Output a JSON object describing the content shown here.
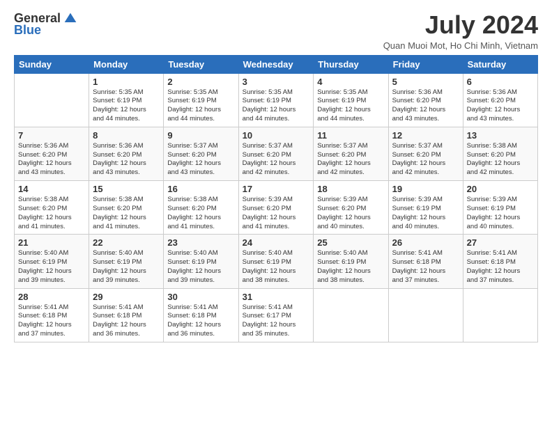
{
  "header": {
    "logo_general": "General",
    "logo_blue": "Blue",
    "title": "July 2024",
    "location": "Quan Muoi Mot, Ho Chi Minh, Vietnam"
  },
  "days_of_week": [
    "Sunday",
    "Monday",
    "Tuesday",
    "Wednesday",
    "Thursday",
    "Friday",
    "Saturday"
  ],
  "weeks": [
    [
      {
        "day": "",
        "info": ""
      },
      {
        "day": "1",
        "info": "Sunrise: 5:35 AM\nSunset: 6:19 PM\nDaylight: 12 hours\nand 44 minutes."
      },
      {
        "day": "2",
        "info": "Sunrise: 5:35 AM\nSunset: 6:19 PM\nDaylight: 12 hours\nand 44 minutes."
      },
      {
        "day": "3",
        "info": "Sunrise: 5:35 AM\nSunset: 6:19 PM\nDaylight: 12 hours\nand 44 minutes."
      },
      {
        "day": "4",
        "info": "Sunrise: 5:35 AM\nSunset: 6:19 PM\nDaylight: 12 hours\nand 44 minutes."
      },
      {
        "day": "5",
        "info": "Sunrise: 5:36 AM\nSunset: 6:20 PM\nDaylight: 12 hours\nand 43 minutes."
      },
      {
        "day": "6",
        "info": "Sunrise: 5:36 AM\nSunset: 6:20 PM\nDaylight: 12 hours\nand 43 minutes."
      }
    ],
    [
      {
        "day": "7",
        "info": "Sunrise: 5:36 AM\nSunset: 6:20 PM\nDaylight: 12 hours\nand 43 minutes."
      },
      {
        "day": "8",
        "info": "Sunrise: 5:36 AM\nSunset: 6:20 PM\nDaylight: 12 hours\nand 43 minutes."
      },
      {
        "day": "9",
        "info": "Sunrise: 5:37 AM\nSunset: 6:20 PM\nDaylight: 12 hours\nand 43 minutes."
      },
      {
        "day": "10",
        "info": "Sunrise: 5:37 AM\nSunset: 6:20 PM\nDaylight: 12 hours\nand 42 minutes."
      },
      {
        "day": "11",
        "info": "Sunrise: 5:37 AM\nSunset: 6:20 PM\nDaylight: 12 hours\nand 42 minutes."
      },
      {
        "day": "12",
        "info": "Sunrise: 5:37 AM\nSunset: 6:20 PM\nDaylight: 12 hours\nand 42 minutes."
      },
      {
        "day": "13",
        "info": "Sunrise: 5:38 AM\nSunset: 6:20 PM\nDaylight: 12 hours\nand 42 minutes."
      }
    ],
    [
      {
        "day": "14",
        "info": "Sunrise: 5:38 AM\nSunset: 6:20 PM\nDaylight: 12 hours\nand 41 minutes."
      },
      {
        "day": "15",
        "info": "Sunrise: 5:38 AM\nSunset: 6:20 PM\nDaylight: 12 hours\nand 41 minutes."
      },
      {
        "day": "16",
        "info": "Sunrise: 5:38 AM\nSunset: 6:20 PM\nDaylight: 12 hours\nand 41 minutes."
      },
      {
        "day": "17",
        "info": "Sunrise: 5:39 AM\nSunset: 6:20 PM\nDaylight: 12 hours\nand 41 minutes."
      },
      {
        "day": "18",
        "info": "Sunrise: 5:39 AM\nSunset: 6:20 PM\nDaylight: 12 hours\nand 40 minutes."
      },
      {
        "day": "19",
        "info": "Sunrise: 5:39 AM\nSunset: 6:19 PM\nDaylight: 12 hours\nand 40 minutes."
      },
      {
        "day": "20",
        "info": "Sunrise: 5:39 AM\nSunset: 6:19 PM\nDaylight: 12 hours\nand 40 minutes."
      }
    ],
    [
      {
        "day": "21",
        "info": "Sunrise: 5:40 AM\nSunset: 6:19 PM\nDaylight: 12 hours\nand 39 minutes."
      },
      {
        "day": "22",
        "info": "Sunrise: 5:40 AM\nSunset: 6:19 PM\nDaylight: 12 hours\nand 39 minutes."
      },
      {
        "day": "23",
        "info": "Sunrise: 5:40 AM\nSunset: 6:19 PM\nDaylight: 12 hours\nand 39 minutes."
      },
      {
        "day": "24",
        "info": "Sunrise: 5:40 AM\nSunset: 6:19 PM\nDaylight: 12 hours\nand 38 minutes."
      },
      {
        "day": "25",
        "info": "Sunrise: 5:40 AM\nSunset: 6:19 PM\nDaylight: 12 hours\nand 38 minutes."
      },
      {
        "day": "26",
        "info": "Sunrise: 5:41 AM\nSunset: 6:18 PM\nDaylight: 12 hours\nand 37 minutes."
      },
      {
        "day": "27",
        "info": "Sunrise: 5:41 AM\nSunset: 6:18 PM\nDaylight: 12 hours\nand 37 minutes."
      }
    ],
    [
      {
        "day": "28",
        "info": "Sunrise: 5:41 AM\nSunset: 6:18 PM\nDaylight: 12 hours\nand 37 minutes."
      },
      {
        "day": "29",
        "info": "Sunrise: 5:41 AM\nSunset: 6:18 PM\nDaylight: 12 hours\nand 36 minutes."
      },
      {
        "day": "30",
        "info": "Sunrise: 5:41 AM\nSunset: 6:18 PM\nDaylight: 12 hours\nand 36 minutes."
      },
      {
        "day": "31",
        "info": "Sunrise: 5:41 AM\nSunset: 6:17 PM\nDaylight: 12 hours\nand 35 minutes."
      },
      {
        "day": "",
        "info": ""
      },
      {
        "day": "",
        "info": ""
      },
      {
        "day": "",
        "info": ""
      }
    ]
  ]
}
